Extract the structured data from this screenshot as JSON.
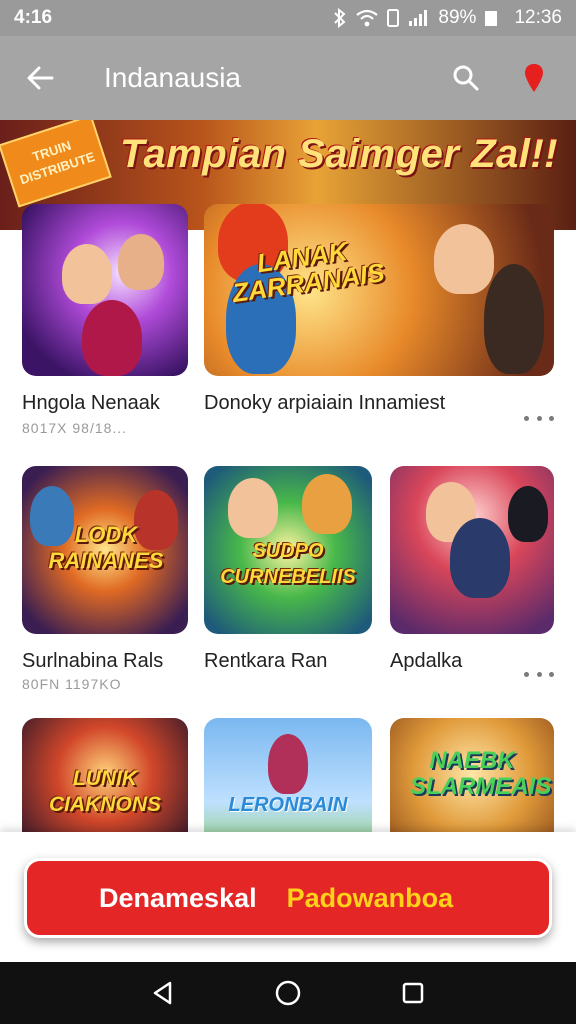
{
  "status_bar": {
    "time_left": "4:16",
    "battery": "89%",
    "clock": "12:36"
  },
  "app_bar": {
    "title": "Indanausia",
    "back_icon": "arrow-left-icon",
    "search_icon": "search-icon",
    "location_icon": "location-pin-icon"
  },
  "banner": {
    "ribbon_text": "TRUIN DISTRIBUTE",
    "headline": "Tampian Saimger Zal!!"
  },
  "featured": {
    "art_text": "LANAK ZARRANAIS"
  },
  "cards_row1": [
    {
      "title": "Hngola Nenaak",
      "subtitle": "8017X 98/18..."
    },
    {
      "title": "Donoky arpiaiain Innamiest",
      "subtitle": ""
    }
  ],
  "cards_row2": [
    {
      "title": "Surlnabina Rals",
      "subtitle": "80FN 1197KO",
      "art_text": "LODK RAINANES"
    },
    {
      "title": "Rentkara Ran",
      "subtitle": "",
      "art_text": "SUDPO CURNEBELIIS"
    },
    {
      "title": "Apdalka",
      "subtitle": "",
      "art_text": ""
    }
  ],
  "cards_row3": [
    {
      "art_text": "LUNIK CIAKNONS"
    },
    {
      "art_text": "LERONBAIN"
    },
    {
      "art_text": "NAEBK SLARMEAIS"
    }
  ],
  "cta": {
    "label_primary": "Denameskal",
    "label_secondary": "Padowanboa"
  },
  "colors": {
    "accent_red": "#e42626",
    "accent_yellow": "#ffd21a",
    "app_bar": "#a5a5a5",
    "status_bar": "#9a9a9a"
  },
  "nav_bar": {
    "back": "triangle-back-icon",
    "home": "circle-home-icon",
    "recents": "square-recents-icon"
  }
}
